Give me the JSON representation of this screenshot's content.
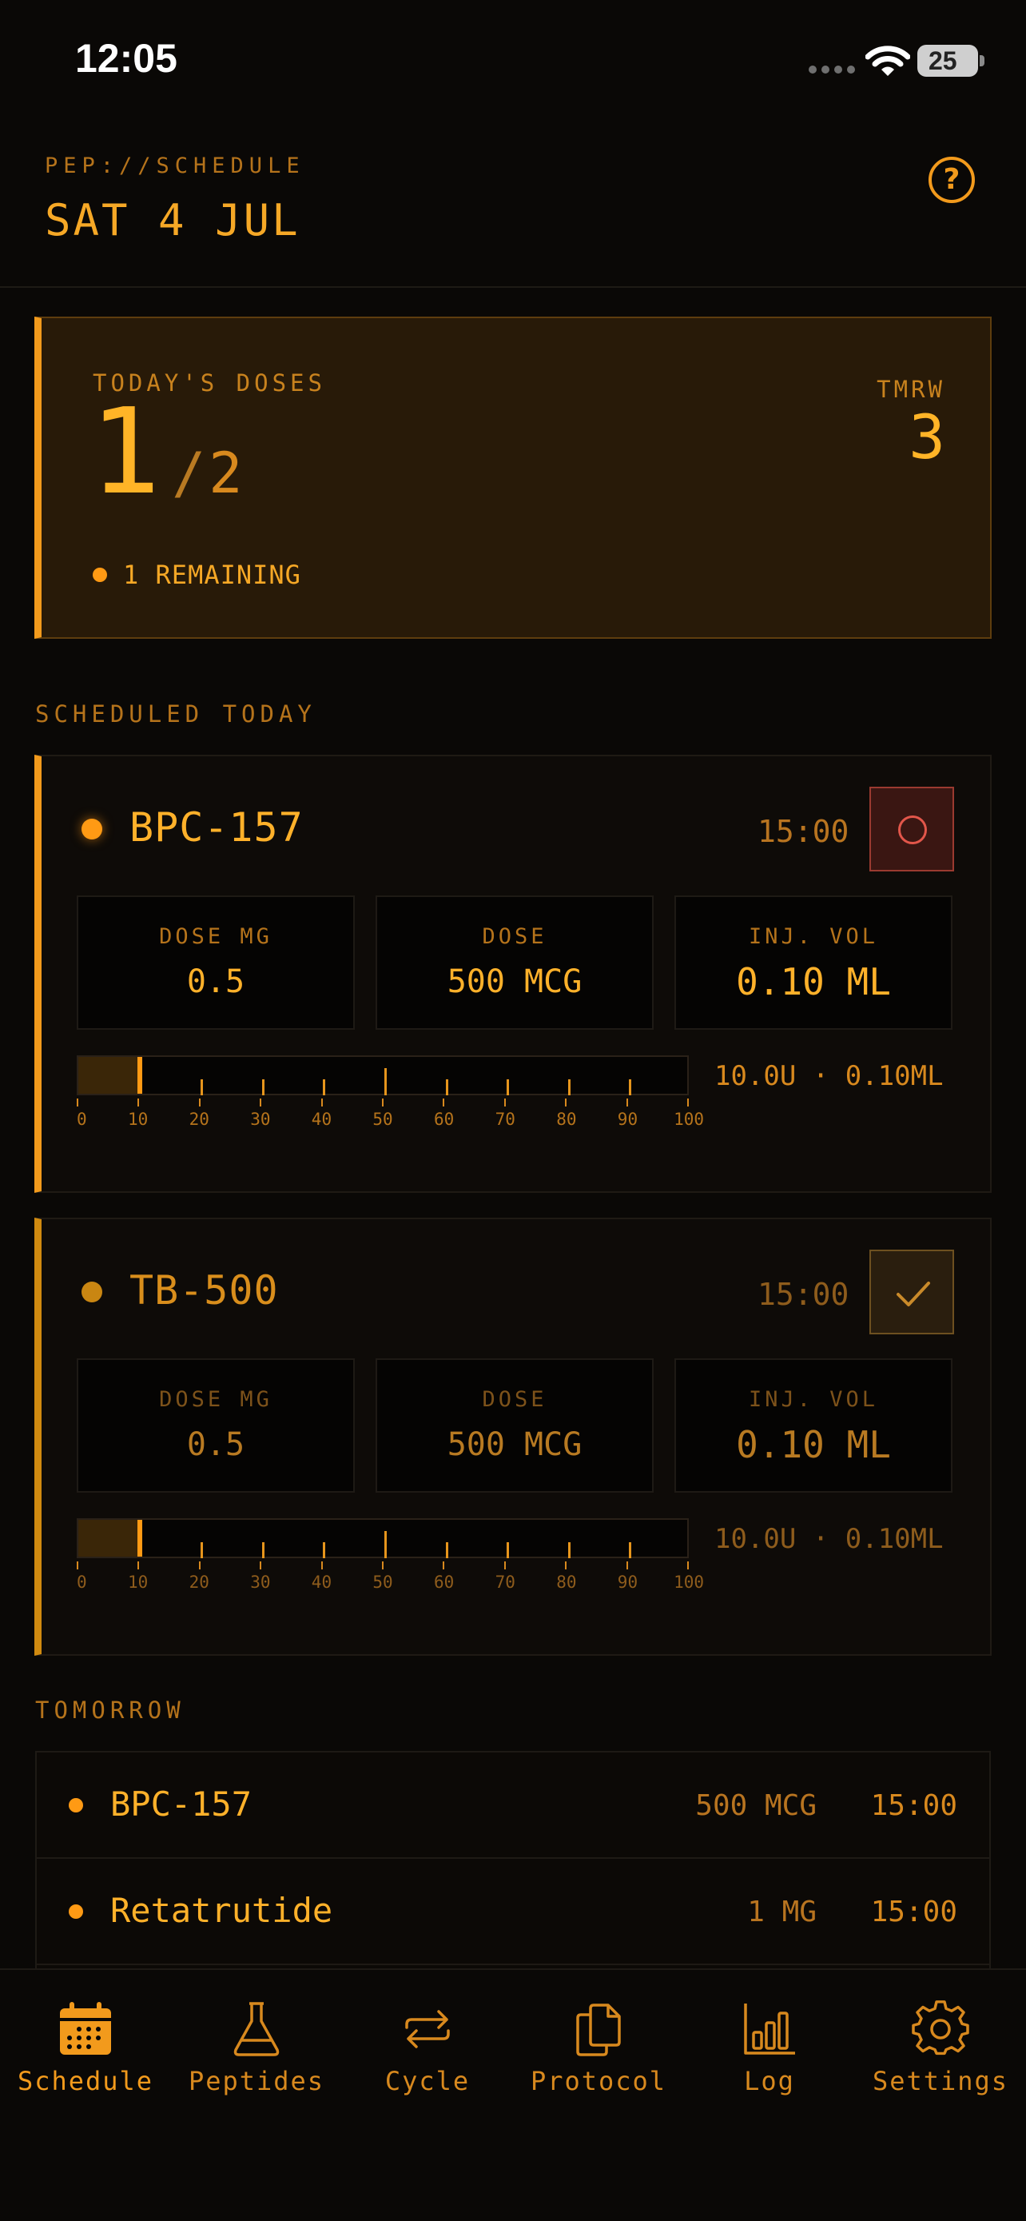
{
  "status_bar": {
    "time": "12:05",
    "battery": "25"
  },
  "header": {
    "kicker": "PEP://SCHEDULE",
    "date": "SAT 4 JUL"
  },
  "summary": {
    "label": "TODAY'S DOSES",
    "done": "1",
    "slash": "/",
    "total": "2",
    "tomorrow_label": "TMRW",
    "tomorrow_count": "3",
    "remaining": "1 REMAINING"
  },
  "sections": {
    "scheduled_today": "SCHEDULED TODAY",
    "tomorrow": "TOMORROW"
  },
  "doses": [
    {
      "name": "BPC-157",
      "time": "15:00",
      "status": "pending",
      "dose_mg_label": "DOSE MG",
      "dose_mg": "0.5",
      "dose_label": "DOSE",
      "dose": "500 MCG",
      "inj_vol_label": "INJ. VOL",
      "inj_vol": "0.10 ML",
      "syringe_units": 10,
      "readout": "10.0U · 0.10ML"
    },
    {
      "name": "TB-500",
      "time": "15:00",
      "status": "done",
      "dose_mg_label": "DOSE MG",
      "dose_mg": "0.5",
      "dose_label": "DOSE",
      "dose": "500 MCG",
      "inj_vol_label": "INJ. VOL",
      "inj_vol": "0.10 ML",
      "syringe_units": 10,
      "readout": "10.0U · 0.10ML"
    }
  ],
  "syringe_scale": [
    "0",
    "10",
    "20",
    "30",
    "40",
    "50",
    "60",
    "70",
    "80",
    "90",
    "100"
  ],
  "tomorrow": [
    {
      "name": "BPC-157",
      "dose": "500 MCG",
      "time": "15:00"
    },
    {
      "name": "Retatrutide",
      "dose": "1 MG",
      "time": "15:00"
    }
  ],
  "tabs": [
    {
      "label": "Schedule",
      "icon": "calendar-icon",
      "active": true
    },
    {
      "label": "Peptides",
      "icon": "flask-icon",
      "active": false
    },
    {
      "label": "Cycle",
      "icon": "repeat-icon",
      "active": false
    },
    {
      "label": "Protocol",
      "icon": "documents-icon",
      "active": false
    },
    {
      "label": "Log",
      "icon": "bar-chart-icon",
      "active": false
    },
    {
      "label": "Settings",
      "icon": "gear-icon",
      "active": false
    }
  ],
  "colors": {
    "accent": "#f29a1c",
    "accent_bright": "#ffb12a",
    "background": "#0a0806",
    "pending_red": "#e2564a"
  }
}
